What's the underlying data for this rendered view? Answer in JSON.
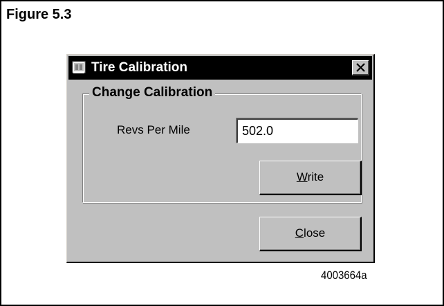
{
  "figure": {
    "caption": "Figure 5.3",
    "id_label": "4003664a"
  },
  "dialog": {
    "title": "Tire Calibration",
    "title_icon": "tire-calibration-app-icon",
    "close_icon": "close-x-icon",
    "group": {
      "legend": "Change Calibration",
      "field_label": "Revs Per Mile",
      "field_value": "502.0",
      "write_button": {
        "mnemonic": "W",
        "rest": "rite"
      }
    },
    "close_button": {
      "mnemonic": "C",
      "rest": "lose"
    }
  },
  "colors": {
    "dialog_face": "#c0c0c0",
    "title_bar": "#000000",
    "title_text": "#ffffff"
  }
}
